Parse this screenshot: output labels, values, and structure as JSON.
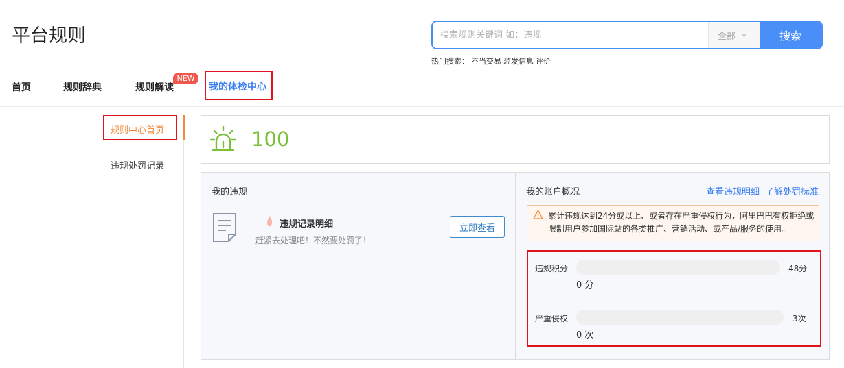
{
  "header": {
    "title": "平台规则"
  },
  "search": {
    "placeholder": "搜索规则关键词 如：违规",
    "value": "",
    "scope": "全部",
    "button": "搜索"
  },
  "hot": {
    "label": "热门搜索：",
    "items": [
      "不当交易",
      "滥发信息",
      "评价"
    ]
  },
  "nav": {
    "items": [
      "首页",
      "规则辞典",
      "规则解读",
      "我的体检中心"
    ],
    "badge": "NEW"
  },
  "sidebar": {
    "items": [
      "规则中心首页",
      "违规处罚记录"
    ]
  },
  "score": {
    "value": "100"
  },
  "violations": {
    "title": "我的违规",
    "record_title": "违规记录明细",
    "record_sub": "赶紧去处理吧！不然要处罚了！",
    "view_button": "立即查看"
  },
  "account": {
    "title": "我的账户概况",
    "link_detail": "查看违规明细",
    "link_standard": "了解处罚标准",
    "warning": "累计违规达到24分或以上、或者存在严重侵权行为，阿里巴巴有权拒绝或限制用户参加国际站的各类推广、营销活动、或产品/服务的使用。",
    "stats": [
      {
        "label": "违规积分",
        "max": "48分",
        "value": "0 分",
        "fraction": 0
      },
      {
        "label": "严重侵权",
        "max": "3次",
        "value": "0 次",
        "fraction": 0
      }
    ]
  },
  "colors": {
    "accent": "#4a8ef8",
    "highlight": "#e0141e",
    "orange": "#f08a3c",
    "green": "#7bbf3a"
  }
}
